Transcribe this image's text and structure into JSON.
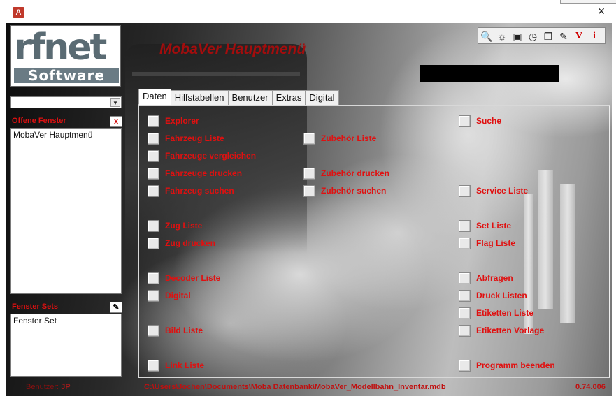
{
  "window": {
    "app_icon_text": "A",
    "close_symbol": "×"
  },
  "logo": {
    "main_text": "rfnet",
    "sub_text": "Software"
  },
  "header": {
    "title": "MobaVer Hauptmenü"
  },
  "toolbar": {
    "items": [
      {
        "name": "search-icon",
        "symbol": "🔍"
      },
      {
        "name": "sun-icon",
        "symbol": "☼"
      },
      {
        "name": "window-icon",
        "symbol": "▣"
      },
      {
        "name": "clock-icon",
        "symbol": "◷"
      },
      {
        "name": "copy-icon",
        "symbol": "❐"
      },
      {
        "name": "pencil-icon",
        "symbol": "✎"
      },
      {
        "name": "v-icon",
        "symbol": "V"
      },
      {
        "name": "info-icon",
        "symbol": "i"
      }
    ]
  },
  "left_panel": {
    "combo_value": "",
    "offene_fenster_label": "Offene Fenster",
    "offene_fenster_close": "x",
    "offene_fenster_items": [
      "MobaVer Hauptmenü"
    ],
    "fenster_sets_label": "Fenster Sets",
    "fenster_sets_edit": "✎",
    "fenster_sets_items": [
      "Fenster Set"
    ]
  },
  "tabs": [
    {
      "label": "Daten",
      "active": true
    },
    {
      "label": "Hilfstabellen",
      "active": false
    },
    {
      "label": "Benutzer",
      "active": false
    },
    {
      "label": "Extras",
      "active": false
    },
    {
      "label": "Digital",
      "active": false
    }
  ],
  "menu": {
    "col1": [
      "Explorer",
      "Fahrzeug Liste",
      "Fahrzeuge vergleichen",
      "Fahrzeuge drucken",
      "Fahrzeug suchen",
      "Zug Liste",
      "Zug drucken",
      "Decoder Liste",
      "Digital",
      "Bild Liste",
      "Link Liste"
    ],
    "col2": [
      "Zubehör Liste",
      "Zubehör drucken",
      "Zubehör suchen"
    ],
    "col3": [
      "Suche",
      "Service Liste",
      "Set Liste",
      "Flag Liste",
      "Abfragen",
      "Druck Listen",
      "Etiketten Liste",
      "Etiketten Vorlage",
      "Programm beenden"
    ]
  },
  "footer": {
    "user_label": "Benutzer:",
    "user_value": "JP",
    "path": "C:\\Users\\Jochen\\Documents\\Moba Datenbank\\MobaVer_Modellbahn_Inventar.mdb",
    "version": "0.74.006"
  }
}
